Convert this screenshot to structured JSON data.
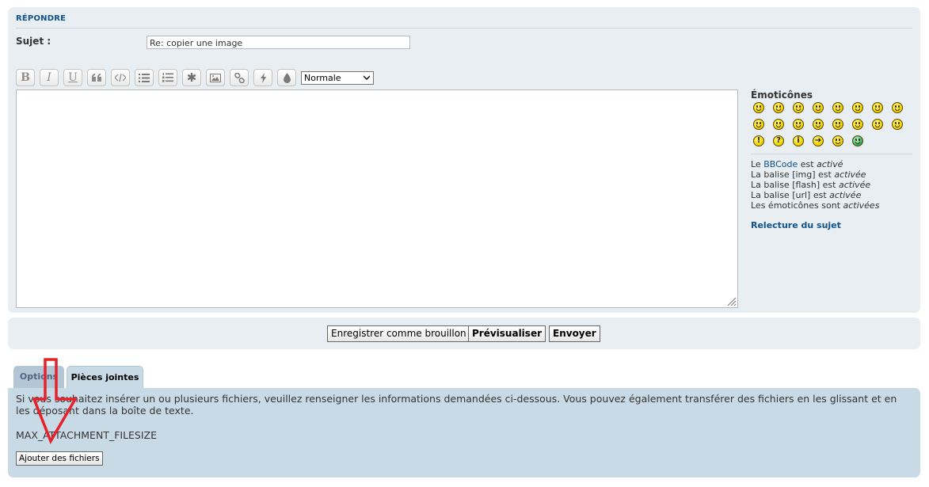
{
  "reply": {
    "section_title": "RÉPONDRE",
    "subject_label": "Sujet :",
    "subject_value": "Re: copier une image"
  },
  "toolbar": {
    "buttons": [
      "bold-icon",
      "italic-icon",
      "underline-icon",
      "quote-icon",
      "code-icon",
      "list-icon",
      "numbered-list-icon",
      "list-item-icon",
      "image-icon",
      "link-icon",
      "flash-icon",
      "color-icon"
    ],
    "bold": "B",
    "italic": "I",
    "underline": "U",
    "list_item": "✱",
    "font_size_selected": "Normale"
  },
  "sidebar": {
    "emoticons_title": "Émoticônes",
    "bbcode_lines": [
      {
        "pre": "Le ",
        "link": "BBCode",
        "mid": " est ",
        "state": "activé"
      },
      {
        "pre": "La balise [img] est ",
        "state": "activée"
      },
      {
        "pre": "La balise [flash] est ",
        "state": "activée"
      },
      {
        "pre": "La balise [url] est ",
        "state": "activée"
      },
      {
        "pre": "Les émoticônes sont ",
        "state": "activées"
      }
    ],
    "relecture": "Relecture du sujet"
  },
  "actions": {
    "save_draft": "Enregistrer comme brouillon",
    "preview": "Prévisualiser",
    "submit": "Envoyer"
  },
  "tabs": {
    "options": "Options",
    "attachments": "Pièces jointes"
  },
  "attachments": {
    "description": "Si vous souhaitez insérer un ou plusieurs fichiers, veuillez renseigner les informations demandées ci-dessous. Vous pouvez également transférer des fichiers en les glissant et en les déposant dans la boîte de texte.",
    "max_size": "MAX_ATTACHMENT_FILESIZE",
    "add_files": "Ajouter des fichiers"
  },
  "annotation": {
    "arrow_color": "#e8202a"
  }
}
